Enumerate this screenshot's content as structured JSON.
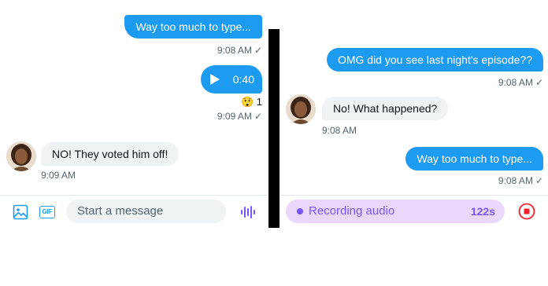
{
  "left_panel": {
    "top_message": {
      "text": "Way too much to type...",
      "time": "9:08 AM"
    },
    "voice_message": {
      "duration": "0:40",
      "reaction_emoji": "😲",
      "reaction_count": "1",
      "time": "9:09 AM"
    },
    "incoming_message": {
      "text": "NO! They voted him off!",
      "time": "9:09 AM"
    },
    "composer": {
      "placeholder": "Start a message",
      "gif_label": "GIF"
    }
  },
  "right_panel": {
    "messages": [
      {
        "direction": "out",
        "text": "OMG did you see last night's episode??",
        "time": "9:08 AM"
      },
      {
        "direction": "in",
        "text": "No! What happened?",
        "time": "9:08 AM"
      },
      {
        "direction": "out",
        "text": "Way too much to type...",
        "time": "9:08 AM"
      }
    ],
    "recording": {
      "label": "Recording audio",
      "seconds": "122s"
    }
  },
  "read_receipt": "✓",
  "colors": {
    "accent_blue": "#1d9bf0",
    "audio_purple": "#7856ff",
    "stop_red": "#f4212e",
    "bubble_gray": "#eff3f4"
  },
  "icons": [
    "image-icon",
    "gif-icon",
    "voice-waveform-icon",
    "play-icon",
    "stop-record-icon"
  ]
}
